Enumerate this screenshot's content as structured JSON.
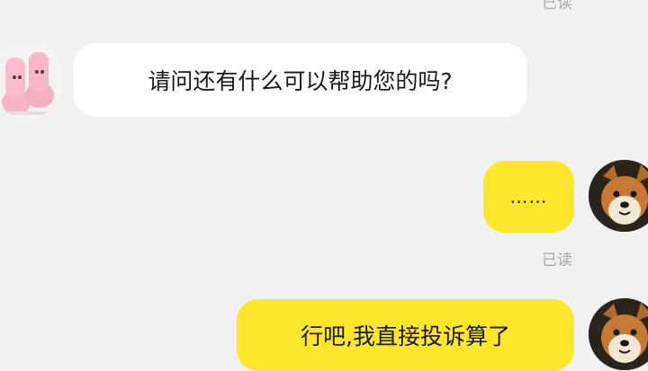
{
  "chat": {
    "top_read_receipt": "已读",
    "messages": [
      {
        "sender": "agent",
        "text": "请问还有什么可以帮助您的吗?",
        "avatar": "pink-mittens-avatar-icon"
      },
      {
        "sender": "user",
        "text": "……",
        "status": "已读",
        "avatar": "shiba-dog-avatar-icon"
      },
      {
        "sender": "user",
        "text": "行吧,我直接投诉算了",
        "avatar": "shiba-dog-avatar-icon"
      }
    ]
  },
  "colors": {
    "background": "#f1f1f1",
    "incoming_bubble": "#ffffff",
    "outgoing_bubble": "#fde62b",
    "read_receipt": "#a8a8a8"
  }
}
